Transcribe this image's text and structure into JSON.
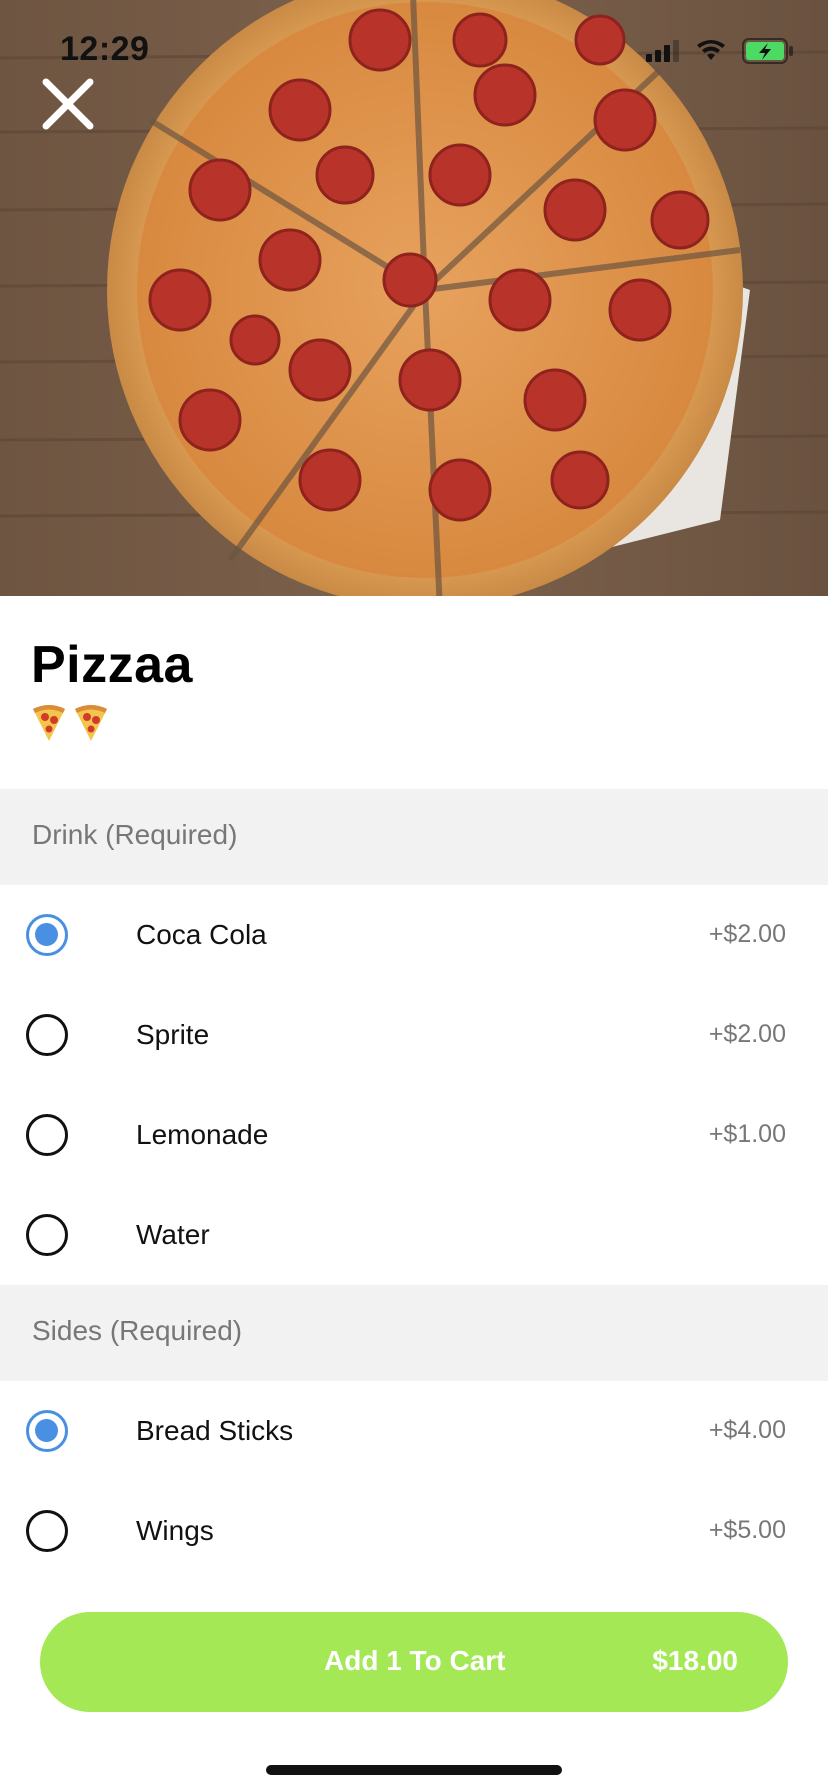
{
  "status_bar": {
    "time": "12:29",
    "battery_color": "#4cd964"
  },
  "hero": {
    "image_subject": "pepperoni pizza on wooden table"
  },
  "item": {
    "title": "Pizzaa",
    "description_emoji": [
      "pizza",
      "pizza"
    ]
  },
  "sections": [
    {
      "header": "Drink (Required)",
      "options": [
        {
          "label": "Coca Cola",
          "price": "+$2.00",
          "selected": true
        },
        {
          "label": "Sprite",
          "price": "+$2.00",
          "selected": false
        },
        {
          "label": "Lemonade",
          "price": "+$1.00",
          "selected": false
        },
        {
          "label": "Water",
          "price": "",
          "selected": false
        }
      ]
    },
    {
      "header": "Sides (Required)",
      "options": [
        {
          "label": "Bread Sticks",
          "price": "+$4.00",
          "selected": true
        },
        {
          "label": "Wings",
          "price": "+$5.00",
          "selected": false
        }
      ]
    }
  ],
  "cart": {
    "label": "Add 1 To Cart",
    "price": "$18.00",
    "color": "#a4e855"
  },
  "colors": {
    "accent": "#4a90e2",
    "section_bg": "#f2f2f2",
    "secondary_text": "#777777"
  }
}
